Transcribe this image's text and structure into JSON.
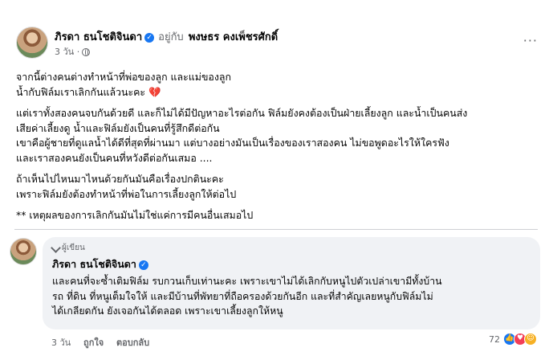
{
  "post": {
    "author": "ภิรดา ธนโชติจินดา",
    "with_label": "อยู่กับ",
    "tagged": "พงษธร คงเพ็ชรศักดิ์",
    "time": "3 วัน ·",
    "more": "···",
    "paragraphs": [
      "จากนี้ต่างคนต่างทำหน้าที่พ่อของลูก และแม่ของลูก\nน้ำกับฟิล์มเราเลิกกันแล้วนะคะ",
      "แต่เราทั้งสองคนจบกันด้วยดี และก็ไม่ได้มีปัญหาอะไรต่อกัน  ฟิล์มยังคงต้องเป็นฝ่ายเลี้ยงลูก  และน้ำเป็นคนส่ง\nเสียค่าเลี้ยงดู  น้ำและฟิล์มยังเป็นคนที่รู้สึกดีต่อกัน\nเขาคือผู้ชายที่ดูแลน้ำได้ดีที่สุดที่ผ่านมา  แต่บางอย่างมันเป็นเรื่องของเราสองคน  ไม่ขอพูดอะไรให้ใครฟัง\nและเราสองคนยังเป็นคนที่หวังดีต่อกันเสมอ  ....",
      "ถ้าเห็นไปไหนมาไหนด้วยกันมันคือเรื่องปกตินะคะ\nเพราะฟิล์มยังต้องทำหน้าที่พ่อในการเลี้ยงลูกให้ต่อไป",
      "**  เหตุผลของการเลิกกันมันไม่ใช่แค่การมีคนอื่นเสมอไป"
    ],
    "heart_emoji": "💔"
  },
  "comment": {
    "badge": "ผู้เขียน",
    "author": "ภิรดา ธนโชติจินดา",
    "text": "และคนที่จะซ้ำเติมฟิล์ม รบกวนเก็บเท่านะคะ เพราะเขาไม่ได้เลิกกับหนูไปตัวเปล่าเขามีทั้งบ้าน\nรถ ที่ดิน ที่หนูเต็มใจให้ และมีบ้านที่พัทยาที่ถือครองด้วยกันอีก และที่สำคัญเลยหนูกับฟิล์มไม่\nได้เกลียดกัน ยังเจอกันได้ตลอด เพราะเขาเลี้ยงลูกให้หนู",
    "time": "3 วัน",
    "like_label": "ถูกใจ",
    "reply_label": "ตอบกลับ",
    "reaction_count": "72"
  },
  "colors": {
    "accent": "#1877f2",
    "secondary_text": "#65676b",
    "bubble_bg": "#f0f2f5"
  }
}
